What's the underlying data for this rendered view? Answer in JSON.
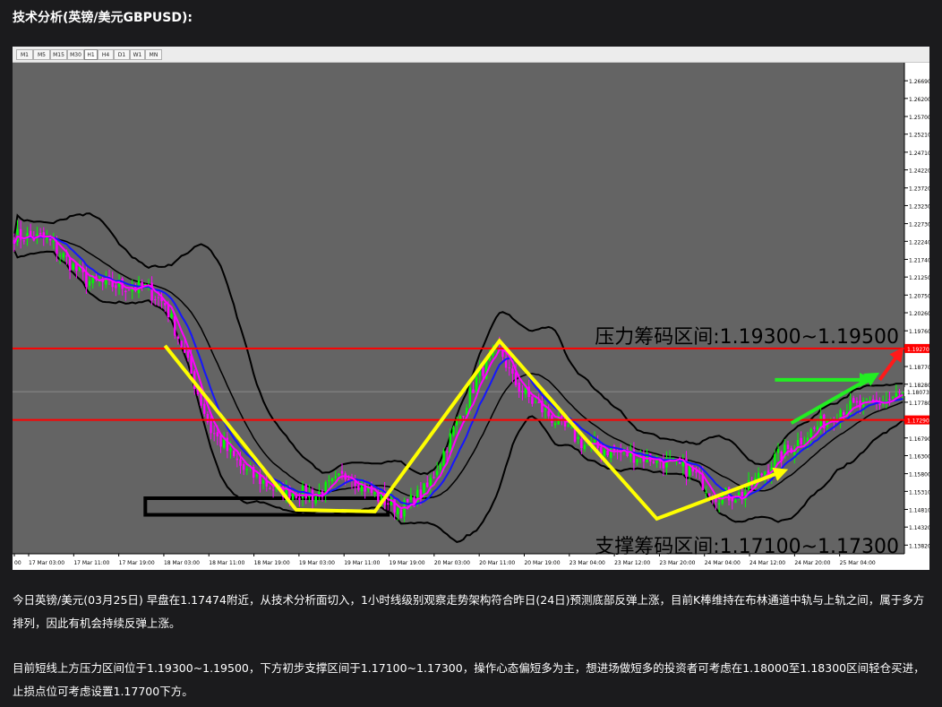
{
  "heading": "技术分析(英镑/美元GBPUSD):",
  "timeframes": [
    "M1",
    "M5",
    "M15",
    "M30",
    "H1",
    "H4",
    "D1",
    "W1",
    "MN"
  ],
  "active_timeframe": "H1",
  "chart_data": {
    "type": "candlestick",
    "instrument": "GBPUSD",
    "timeframe": "H1",
    "ylim": [
      1.1358,
      1.2719
    ],
    "y_ticks": [
      1.2669,
      1.262,
      1.257,
      1.2521,
      1.2471,
      1.2422,
      1.2372,
      1.2323,
      1.2273,
      1.2224,
      1.2174,
      1.2125,
      1.2075,
      1.2026,
      1.1976,
      1.1927,
      1.1877,
      1.1828,
      1.1778,
      1.1729,
      1.1679,
      1.163,
      1.158,
      1.1531,
      1.1481,
      1.1432,
      1.1382
    ],
    "y_tick_labels": [
      "1.26690",
      "1.26200",
      "1.25700",
      "1.25210",
      "1.24710",
      "1.24220",
      "1.23720",
      "1.23230",
      "1.22730",
      "1.22240",
      "1.21740",
      "1.21250",
      "1.20750",
      "1.20260",
      "1.19760",
      "1.19270",
      "1.18770",
      "1.18280",
      "1.17780",
      "1.17290",
      "1.16790",
      "1.16300",
      "1.15800",
      "1.15310",
      "1.14810",
      "1.14320",
      "1.13820"
    ],
    "x_labels": [
      "00",
      "17 Mar 03:00",
      "17 Mar 11:00",
      "17 Mar 19:00",
      "18 Mar 03:00",
      "18 Mar 11:00",
      "18 Mar 19:00",
      "19 Mar 03:00",
      "19 Mar 11:00",
      "19 Mar 19:00",
      "20 Mar 03:00",
      "20 Mar 11:00",
      "20 Mar 19:00",
      "23 Mar 04:00",
      "23 Mar 12:00",
      "23 Mar 20:00",
      "24 Mar 04:00",
      "24 Mar 12:00",
      "24 Mar 20:00",
      "25 Mar 04:00"
    ],
    "current_price": 1.18073,
    "resistance_line": 1.1927,
    "support_line": 1.1729,
    "annotations": {
      "resistance_label": "压力筹码区间:1.19300~1.19500",
      "support_label": "支撑筹码区间:1.17100~1.17300",
      "resistance_level_tag": "1.19270",
      "support_level_tag": "1.17290",
      "current_price_tag": "1.18073"
    },
    "anchors": [
      [
        0,
        1.224
      ],
      [
        10,
        1.223
      ],
      [
        22,
        1.2115
      ],
      [
        32,
        1.21
      ],
      [
        40,
        1.2095
      ],
      [
        46,
        1.205
      ],
      [
        50,
        1.196
      ],
      [
        60,
        1.17
      ],
      [
        70,
        1.159
      ],
      [
        80,
        1.1535
      ],
      [
        92,
        1.152
      ],
      [
        102,
        1.158
      ],
      [
        110,
        1.152
      ],
      [
        118,
        1.148
      ],
      [
        126,
        1.154
      ],
      [
        134,
        1.17
      ],
      [
        142,
        1.186
      ],
      [
        148,
        1.193
      ],
      [
        152,
        1.184
      ],
      [
        158,
        1.178
      ],
      [
        166,
        1.172
      ],
      [
        174,
        1.166
      ],
      [
        184,
        1.164
      ],
      [
        196,
        1.162
      ],
      [
        206,
        1.159
      ],
      [
        214,
        1.152
      ],
      [
        222,
        1.152
      ],
      [
        232,
        1.162
      ],
      [
        242,
        1.169
      ],
      [
        252,
        1.176
      ],
      [
        262,
        1.177
      ],
      [
        271,
        1.18
      ]
    ],
    "colors": {
      "bull": "#00ff00",
      "bear": "#ff00ff",
      "ma_fast": "#ff00ff",
      "ma_slow": "#1515ff",
      "bollinger": "#000000",
      "level": "#ff0000",
      "arrow": "#ffff00",
      "arrow_green": "#22ee22",
      "arrow_red": "#ff1a1a",
      "background": "#646464"
    }
  },
  "paragraphs": [
    "今日英镑/美元(03月25日) 早盘在1.17474附近，从技术分析面切入，1小时线级别观察走势架构符合昨日(24日)预测底部反弹上涨，目前K棒维持在布林通道中轨与上轨之间，属于多方排列，因此有机会持续反弹上涨。",
    "目前短线上方压力区间位于1.19300~1.19500，下方初步支撑区间于1.17100~1.17300，操作心态偏短多为主，想进场做短多的投资者可考虑在1.18000至1.18300区间轻仓买进，止损点位可考虑设置1.17700下方。"
  ]
}
